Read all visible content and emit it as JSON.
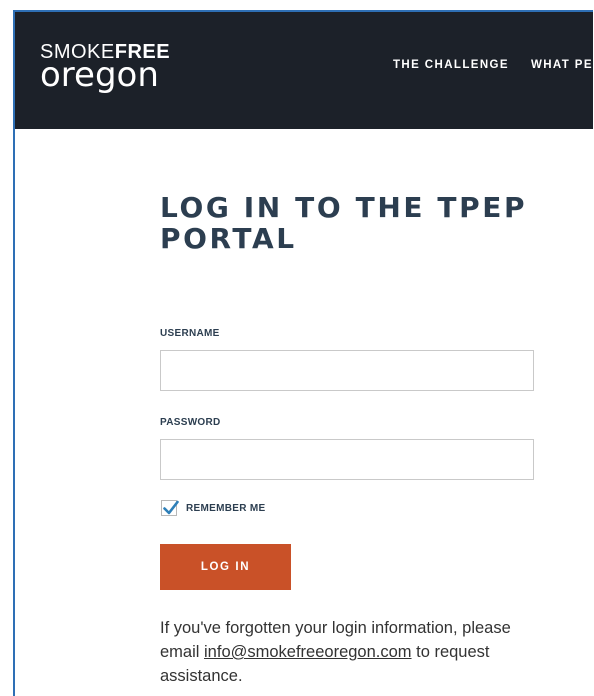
{
  "brand": {
    "logo_top_regular": "SMOKE",
    "logo_top_bold": "FREE",
    "logo_bottom": "oregon"
  },
  "nav": {
    "items": [
      {
        "label": "THE CHALLENGE"
      },
      {
        "label": "WHAT PEC"
      }
    ]
  },
  "login": {
    "title": "LOG IN TO THE TPEP PORTAL",
    "username_label": "USERNAME",
    "username_value": "",
    "password_label": "PASSWORD",
    "password_value": "",
    "remember_label": "REMEMBER ME",
    "remember_checked": true,
    "submit_label": "LOG IN"
  },
  "help": {
    "text_before": "If you've forgotten your login information, please email ",
    "email": "info@smokefreeoregon.com",
    "text_after": " to request assistance."
  },
  "colors": {
    "header_bg": "#1c2129",
    "accent": "#c95128",
    "heading": "#2c3e50",
    "check": "#2e7fb8"
  }
}
